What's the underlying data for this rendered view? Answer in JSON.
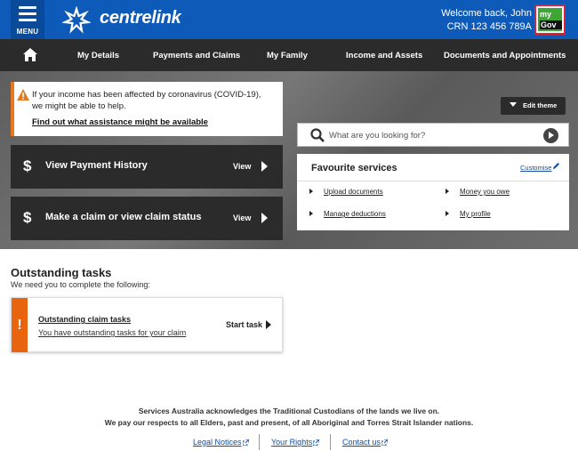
{
  "header": {
    "menu_label": "MENU",
    "brand": "centrelink",
    "welcome": "Welcome back, John",
    "crn": "CRN 123 456 789A",
    "mygov_top": "my",
    "mygov_bottom": "Gov"
  },
  "nav": {
    "items": [
      "My Details",
      "Payments and Claims",
      "My Family",
      "Income and Assets",
      "Documents and Appointments"
    ]
  },
  "covid": {
    "message": "If your income has been affected by coronavirus (COVID-19), we might be able to help.",
    "link": "Find out what assistance might be available"
  },
  "actions": [
    {
      "title": "View Payment History",
      "cta": "View"
    },
    {
      "title": "Make a claim or view claim status",
      "cta": "View"
    }
  ],
  "edit_theme": "Edit theme",
  "search": {
    "placeholder": "What are you looking for?"
  },
  "favourites": {
    "title": "Favourite services",
    "customise": "Customise",
    "items": [
      "Upload documents",
      "Money you owe",
      "Manage deductions",
      "My profile"
    ]
  },
  "outstanding": {
    "title": "Outstanding tasks",
    "subtitle": "We need you to complete the following:",
    "task_badge": "!",
    "task_title": "Outstanding claim tasks",
    "task_desc": "You have outstanding tasks for your claim",
    "start": "Start task"
  },
  "footer": {
    "ack1": "Services Australia acknowledges the Traditional Custodians of the lands we live on.",
    "ack2": "We pay our respects to all Elders, past and present, of all Aboriginal and Torres Strait Islander nations.",
    "links": [
      "Legal Notices",
      "Your Rights",
      "Contact us"
    ]
  },
  "colors": {
    "header_blue": "#0d5ab8",
    "nav_dark": "#2b2b2b",
    "alert_orange": "#e8791f",
    "task_orange": "#e8640f",
    "link_blue": "#0d4fa3",
    "mygov_green": "#3fa535",
    "mygov_border": "#e0202a"
  },
  "icons": {
    "menu": "hamburger-icon",
    "logo": "centrelink-star-icon",
    "home": "home-icon",
    "warning": "warning-icon",
    "search": "magnifier-icon",
    "edit": "pencil-icon",
    "external": "external-link-icon"
  }
}
